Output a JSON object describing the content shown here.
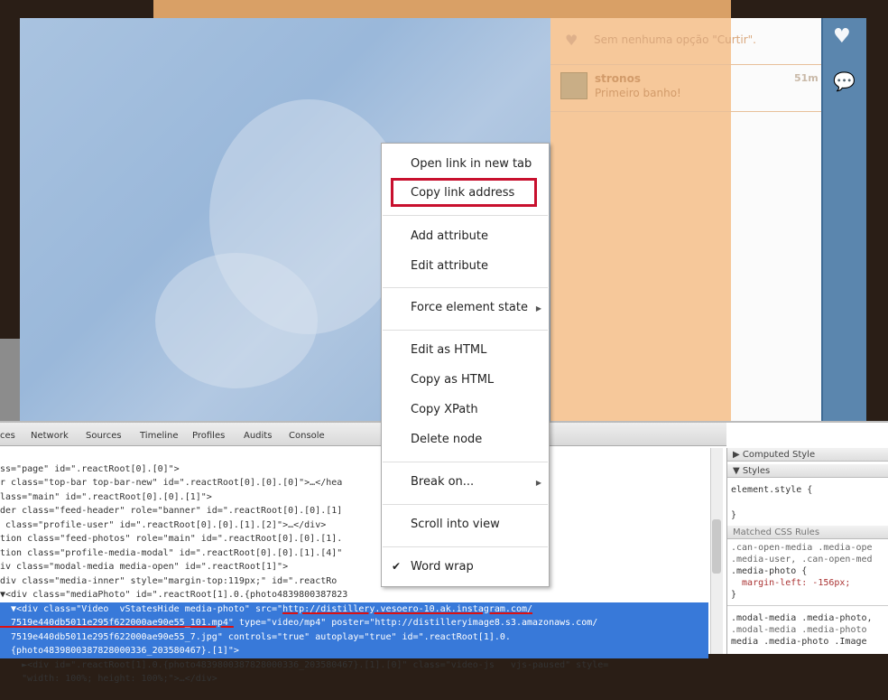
{
  "post": {
    "likes_text": "Sem nenhuma opção \"Curtir\".",
    "comment": {
      "user": "stronos",
      "text": "Primeiro banho!",
      "time": "51m"
    }
  },
  "devtools": {
    "tabs": [
      "ces",
      "Network",
      "Sources",
      "Timeline",
      "Profiles",
      "Audits",
      "Console"
    ],
    "code_lines": [
      "ss=\"page\" id=\".reactRoot[0].[0]\">",
      "r class=\"top-bar top-bar-new\" id=\".reactRoot[0].[0].[0]\">…</hea",
      "lass=\"main\" id=\".reactRoot[0].[0].[1]\">",
      "der class=\"feed-header\" role=\"banner\" id=\".reactRoot[0].[0].[1]",
      " class=\"profile-user\" id=\".reactRoot[0].[0].[1].[2]\">…</div>",
      "tion class=\"feed-photos\" role=\"main\" id=\".reactRoot[0].[0].[1].",
      "tion class=\"profile-media-modal\" id=\".reactRoot[0].[0].[1].[4]\"",
      "iv class=\"modal-media media-open\" id=\".reactRoot[1]\">",
      "div class=\"media-inner\" style=\"margin-top:119px;\" id=\".reactRo",
      "▼<div class=\"mediaPhoto\" id=\".reactRoot[1].0.{photo4839800387823"
    ],
    "selected": {
      "l1_a": "  ▼<div class=\"Video  vStatesHide media-photo\" src=\"",
      "l1_b": "http://distillery.vesoero-10.ak.instagram.com/",
      "l2_a": "  7519e440db5011e295f622000ae90e55_101.mp4\"",
      "l2_b": " type=\"video/mp4\" poster=\"http://distilleryimage8.s3.amazonaws.com/",
      "l3": "  7519e440db5011e295f622000ae90e55_7.jpg\" controls=\"true\" autoplay=\"true\" id=\".reactRoot[1].0.",
      "l4": "  {photo4839800387828000336_203580467}.[1]\">"
    },
    "after_lines": [
      "    ►<div id=\".reactRoot[1].0.{photo4839800387828000336_203580467}.[1].[0]\" class=\"video-js   vjs-paused\" style=",
      "    \"width: 100%; height: 100%;\">…</div>"
    ],
    "sidebar": {
      "computed": "▶ Computed Style",
      "styles": "▼ Styles",
      "element_style": "element.style {",
      "close": "}",
      "matched": "Matched CSS Rules",
      "rule1": [
        ".can-open-media .media-ope",
        ".media-user, .can-open-med",
        ".media-photo {",
        "  margin-left: -156px;",
        "}"
      ],
      "rule2": [
        ".modal-media .media-photo,",
        ".modal-media .media-photo",
        "media .media-photo .Image"
      ]
    }
  },
  "context_menu": {
    "items": [
      "Open link in new tab",
      "Copy link address",
      "Add attribute",
      "Edit attribute",
      "Force element state",
      "Edit as HTML",
      "Copy as HTML",
      "Copy XPath",
      "Delete node",
      "Break on...",
      "Scroll into view",
      "Word wrap"
    ],
    "highlighted": "Copy link address",
    "highlight_color": "#c8102e"
  }
}
